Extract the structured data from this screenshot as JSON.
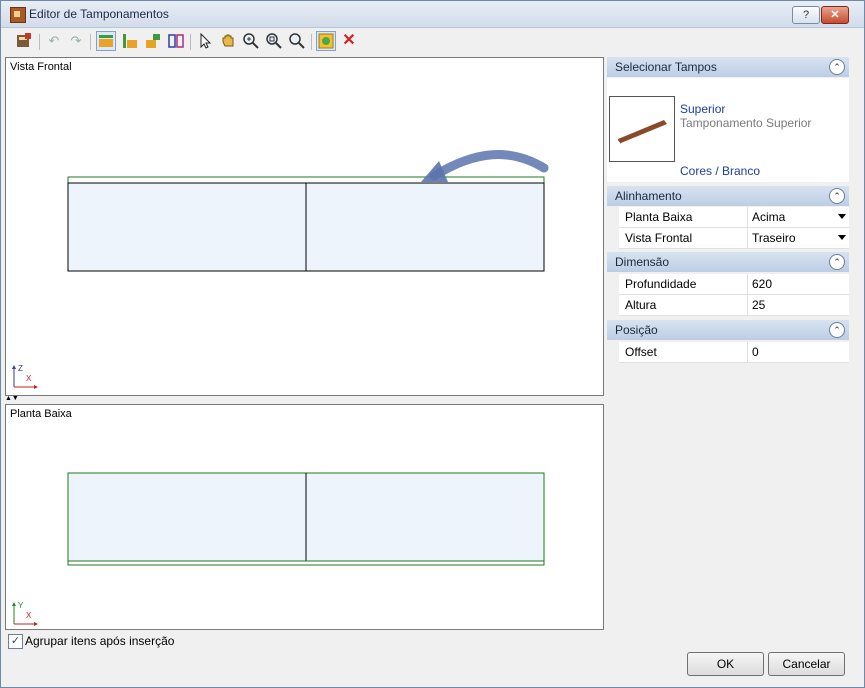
{
  "window": {
    "title": "Editor de Tamponamentos",
    "help_label": "?",
    "close_label": "✕"
  },
  "toolbar": {
    "icons": [
      "editor-icon",
      "undo-icon",
      "redo-icon",
      "top-view-icon",
      "side-view-icon",
      "corner-view-icon",
      "split-view-icon",
      "select-icon",
      "pan-icon",
      "zoom-in-icon",
      "zoom-window-icon",
      "zoom-fit-icon",
      "insert-icon",
      "delete-icon"
    ]
  },
  "views": {
    "front_label": "Vista Frontal",
    "plan_label": "Planta Baixa",
    "front_axis_v": "Z",
    "front_axis_h": "X",
    "plan_axis_v": "Y",
    "plan_axis_h": "X"
  },
  "select_tampos": {
    "title": "Selecionar Tampos",
    "item_name": "Superior",
    "item_desc": "Tamponamento Superior",
    "item_material": "Cores / Branco"
  },
  "alinhamento": {
    "title": "Alinhamento",
    "planta_label": "Planta Baixa",
    "planta_value": "Acima",
    "vista_label": "Vista Frontal",
    "vista_value": "Traseiro"
  },
  "dimensao": {
    "title": "Dimensão",
    "prof_label": "Profundidade",
    "prof_value": "620",
    "altura_label": "Altura",
    "altura_value": "25"
  },
  "posicao": {
    "title": "Posição",
    "offset_label": "Offset",
    "offset_value": "0"
  },
  "footer": {
    "group_label": "Agrupar itens após inserção",
    "group_checked": true,
    "ok_label": "OK",
    "cancel_label": "Cancelar"
  }
}
